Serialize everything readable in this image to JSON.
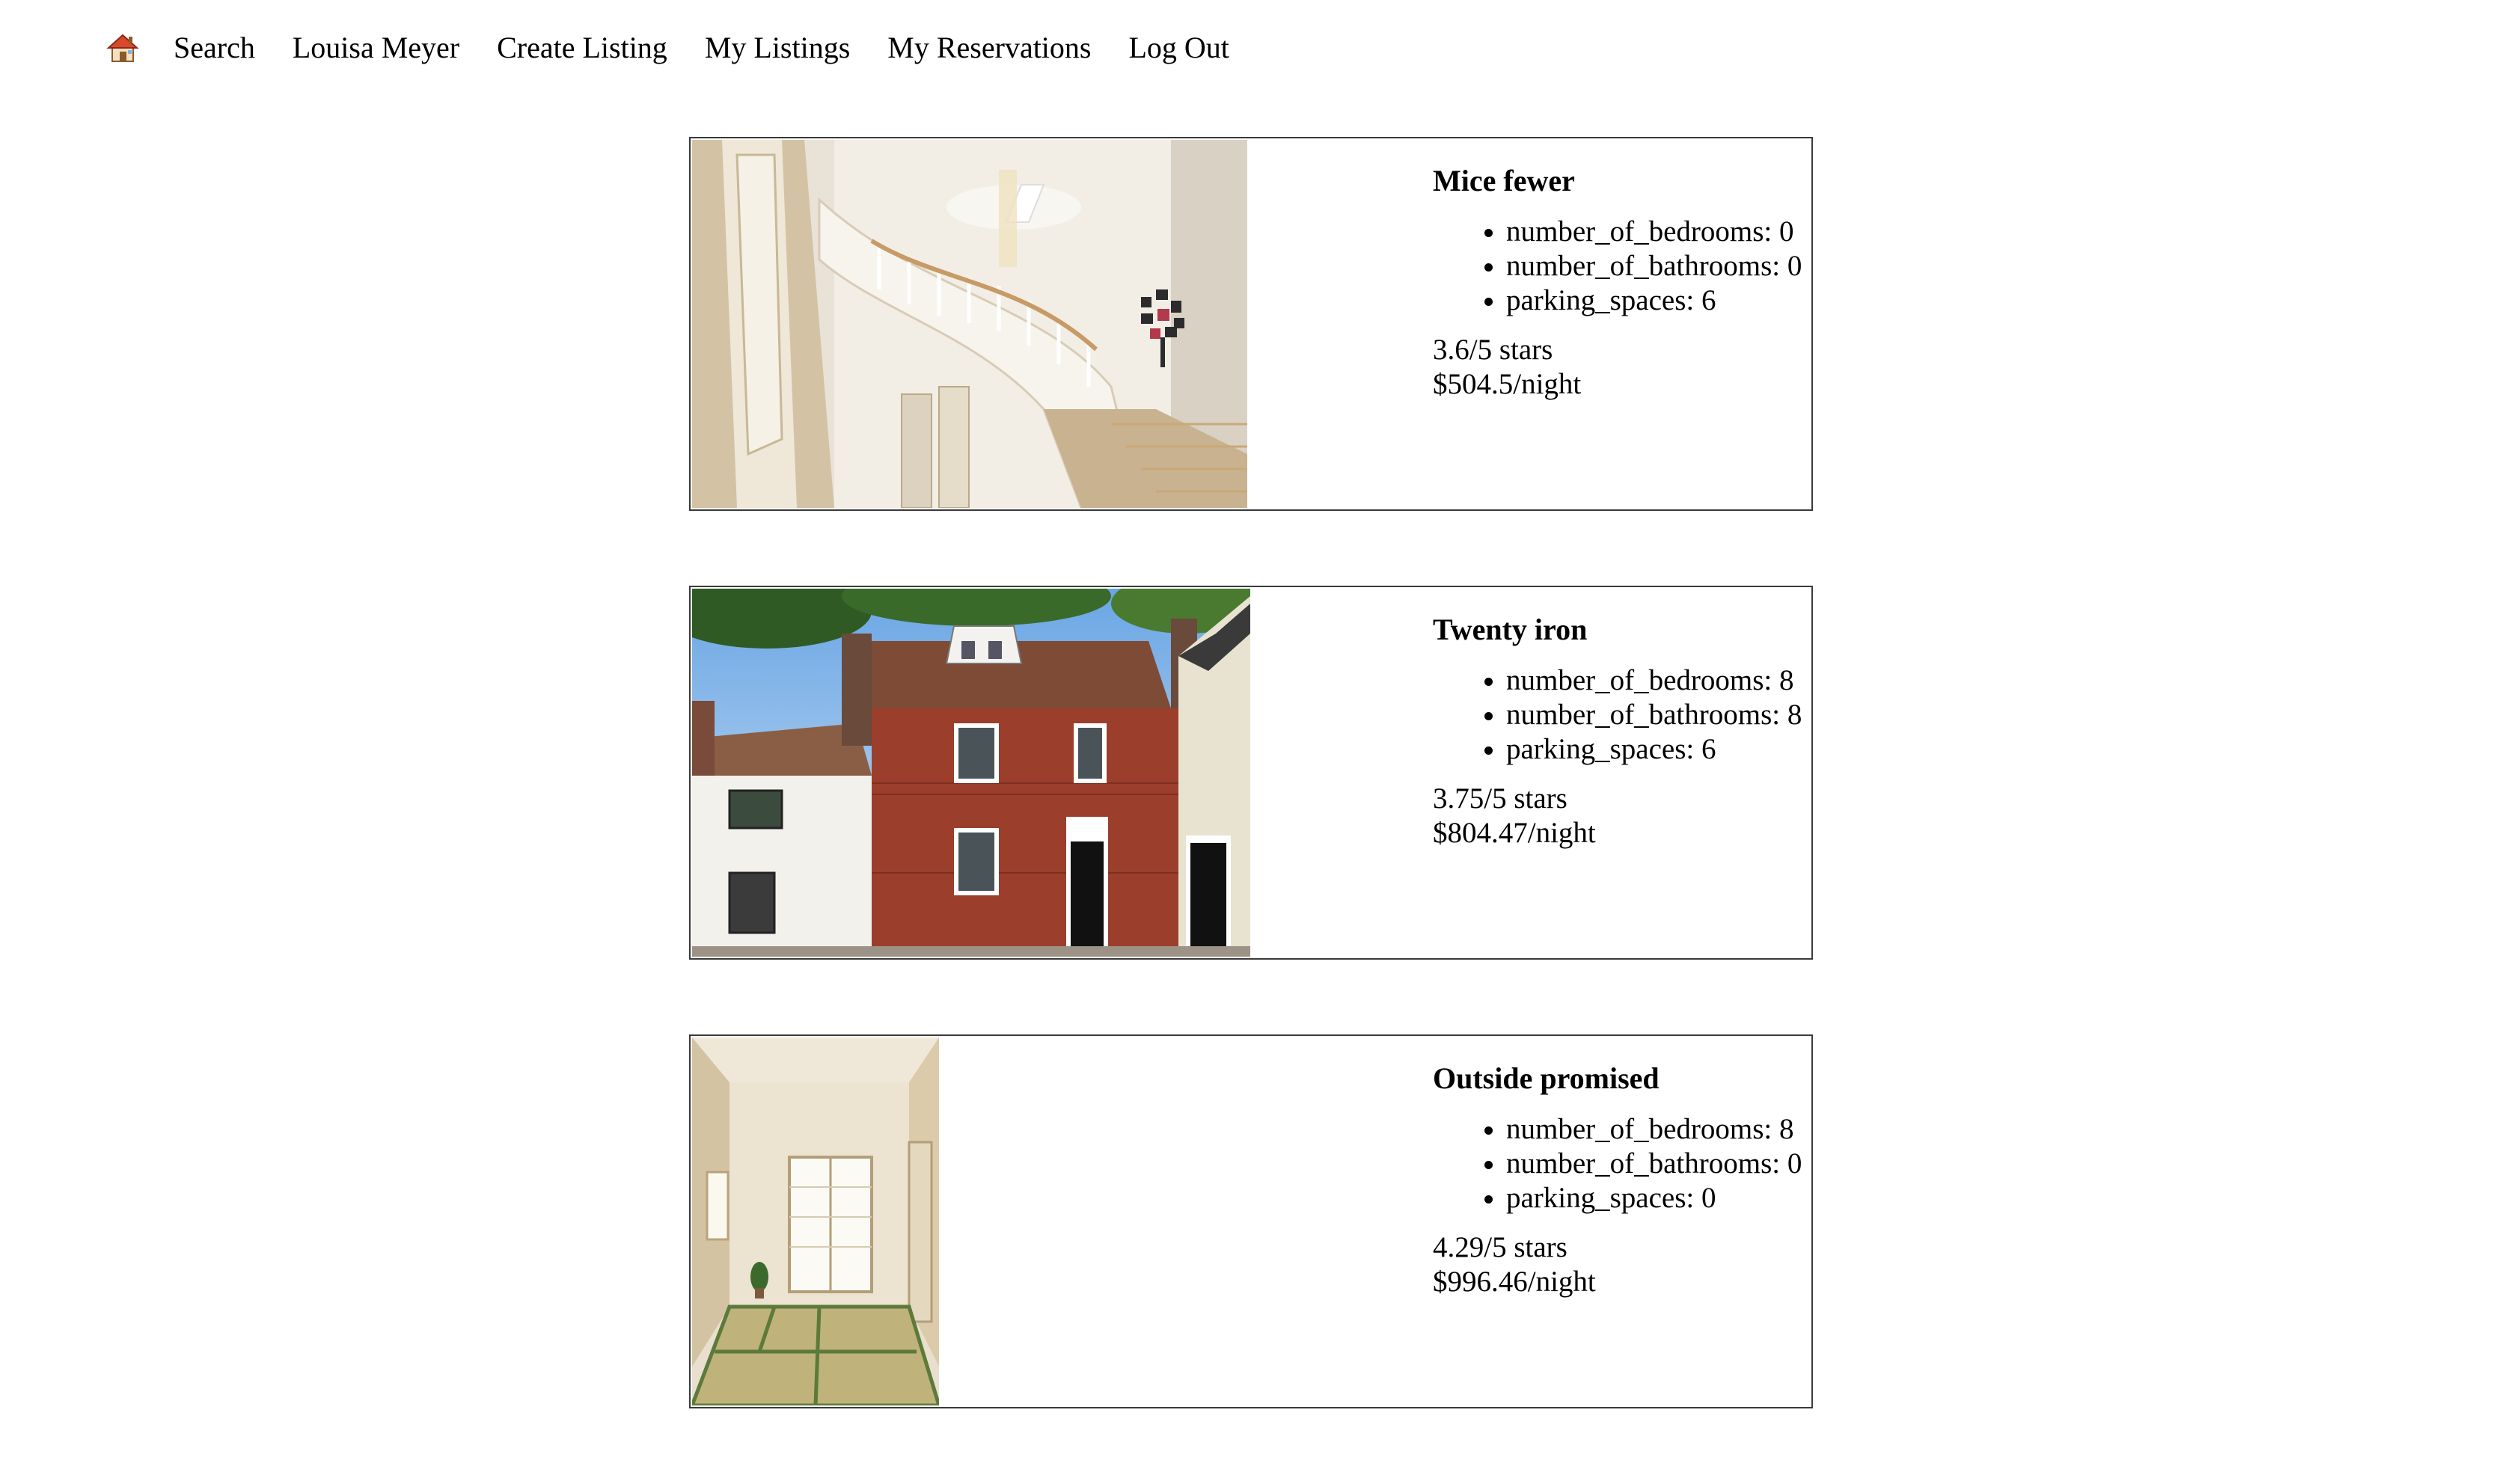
{
  "nav": {
    "home_icon": "house-emoji-icon",
    "links": [
      "Search",
      "Louisa Meyer",
      "Create Listing",
      "My Listings",
      "My Reservations",
      "Log Out"
    ]
  },
  "listings": [
    {
      "title": "Mice fewer",
      "features": [
        "number_of_bedrooms: 0",
        "number_of_bathrooms: 0",
        "parking_spaces: 6"
      ],
      "rating": "3.6/5 stars",
      "price": "$504.5/night",
      "image_subject": "interior-staircase-photo"
    },
    {
      "title": "Twenty iron",
      "features": [
        "number_of_bedrooms: 8",
        "number_of_bathrooms: 8",
        "parking_spaces: 6"
      ],
      "rating": "3.75/5 stars",
      "price": "$804.47/night",
      "image_subject": "brick-house-photo"
    },
    {
      "title": "Outside promised",
      "features": [
        "number_of_bedrooms: 8",
        "number_of_bathrooms: 0",
        "parking_spaces: 0"
      ],
      "rating": "4.29/5 stars",
      "price": "$996.46/night",
      "image_subject": "tatami-room-photo"
    }
  ]
}
